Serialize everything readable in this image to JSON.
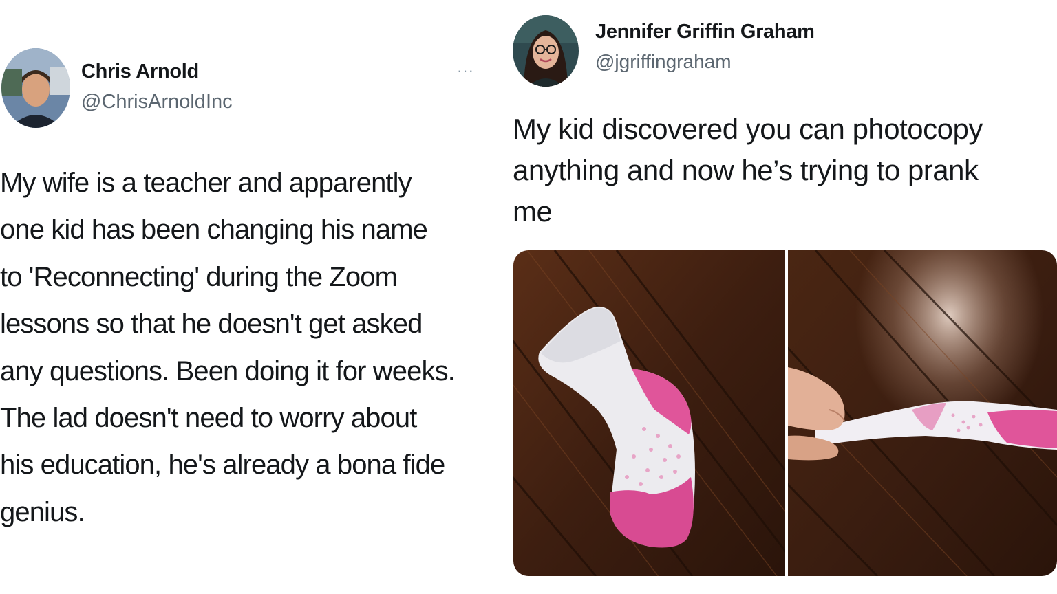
{
  "tweets": [
    {
      "author": {
        "name": "Chris Arnold",
        "handle": "@ChrisArnoldInc"
      },
      "more_label": "···",
      "text_lines": [
        "My wife is a teacher and apparently",
        "one kid has been changing his name",
        "to 'Reconnecting' during the Zoom",
        "lessons so that he doesn't get asked",
        "any questions. Been doing it for weeks.",
        "The lad doesn't need to worry about",
        "his education, he's already a bona fide",
        "genius."
      ]
    },
    {
      "author": {
        "name": "Jennifer Griffin Graham",
        "handle": "@jgriffingraham"
      },
      "text_lines": [
        "My kid discovered you can photocopy",
        "anything and now he’s trying to prank",
        "me"
      ],
      "photos": [
        {
          "subject": "sock on wood floor"
        },
        {
          "subject": "hand holding paper photocopy of sock"
        }
      ]
    }
  ],
  "colors": {
    "text": "#14171a",
    "secondary_text": "#5b6670",
    "wood_dark": "#3a1d10",
    "wood_mid": "#6b3a1f",
    "sock_pink": "#e0559a",
    "sock_white": "#ecebef"
  }
}
